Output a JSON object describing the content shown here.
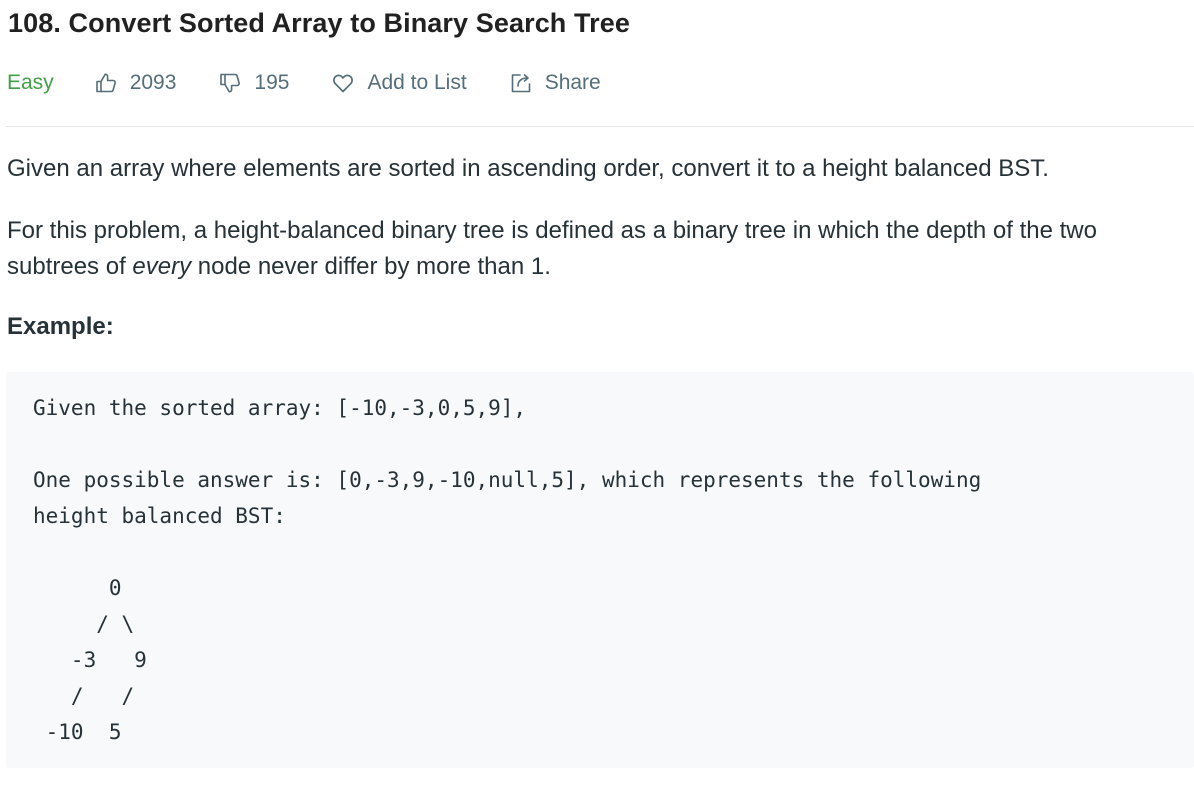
{
  "problem": {
    "title": "108. Convert Sorted Array to Binary Search Tree",
    "difficulty": "Easy",
    "likes": "2093",
    "dislikes": "195",
    "add_to_list_label": "Add to List",
    "share_label": "Share"
  },
  "description": {
    "paragraph_1": "Given an array where elements are sorted in ascending order, convert it to a height balanced BST.",
    "paragraph_2_before": "For this problem, a height-balanced binary tree is defined as a binary tree in which the depth of the two subtrees of ",
    "paragraph_2_emphasis": "every",
    "paragraph_2_after": " node never differ by more than 1.",
    "example_label": "Example:"
  },
  "example_code": [
    "Given the sorted array: [-10,-3,0,5,9],",
    "",
    "One possible answer is: [0,-3,9,-10,null,5], which represents the following",
    "height balanced BST:",
    "",
    "      0",
    "     / \\",
    "   -3   9",
    "   /   /",
    " -10  5"
  ],
  "icons": {
    "likes": "thumbs-up-icon",
    "dislikes": "thumbs-down-icon",
    "add_to_list": "heart-icon",
    "share": "share-icon"
  },
  "colors": {
    "difficulty": "#43a047",
    "meta_text": "#546e7a",
    "title": "#212121",
    "body_text": "#263238",
    "code_background": "#f7f9fa"
  }
}
